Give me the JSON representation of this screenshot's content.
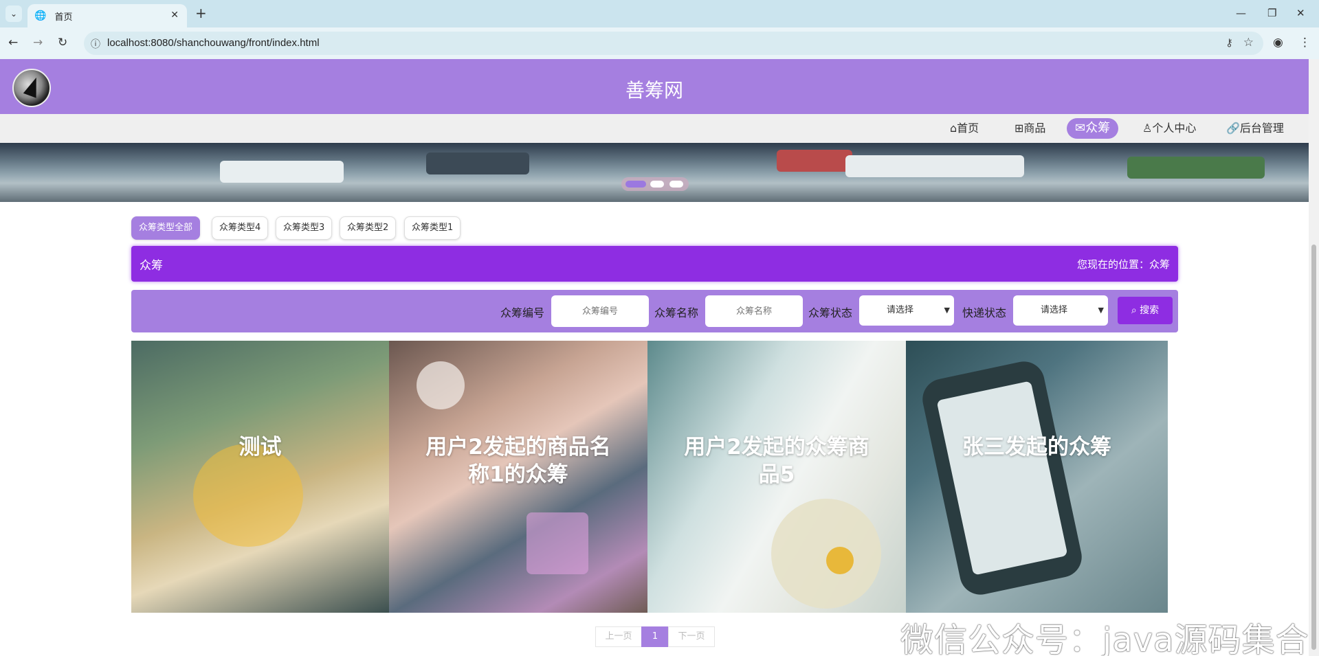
{
  "browser": {
    "tab_title": "首页",
    "url": "localhost:8080/shanchouwang/front/index.html"
  },
  "site": {
    "title": "善筹网"
  },
  "nav": {
    "items": [
      {
        "icon": "home-icon",
        "label": "首页"
      },
      {
        "icon": "gift-icon",
        "label": "商品"
      },
      {
        "icon": "mail-icon",
        "label": "众筹",
        "active": true
      },
      {
        "icon": "user-icon",
        "label": "个人中心"
      },
      {
        "icon": "link-icon",
        "label": "后台管理"
      }
    ]
  },
  "categories": {
    "items": [
      "众筹类型全部",
      "众筹类型4",
      "众筹类型3",
      "众筹类型2",
      "众筹类型1"
    ],
    "active_index": 0
  },
  "section": {
    "title": "众筹",
    "breadcrumb": "您现在的位置：众筹"
  },
  "search": {
    "number_label": "众筹编号",
    "number_placeholder": "众筹编号",
    "name_label": "众筹名称",
    "name_placeholder": "众筹名称",
    "status_label": "众筹状态",
    "status_value": "请选择",
    "express_label": "快递状态",
    "express_value": "请选择",
    "button_label": "搜索"
  },
  "cards": [
    {
      "title": "测试"
    },
    {
      "title": "用户2发起的商品名称1的众筹"
    },
    {
      "title": "用户2发起的众筹商品5"
    },
    {
      "title": "张三发起的众筹"
    }
  ],
  "pagination": {
    "prev": "上一页",
    "current": "1",
    "next": "下一页"
  },
  "watermark": "微信公众号：java源码集合",
  "colors": {
    "accent": "#a57fe0",
    "primary": "#8e2de2"
  }
}
